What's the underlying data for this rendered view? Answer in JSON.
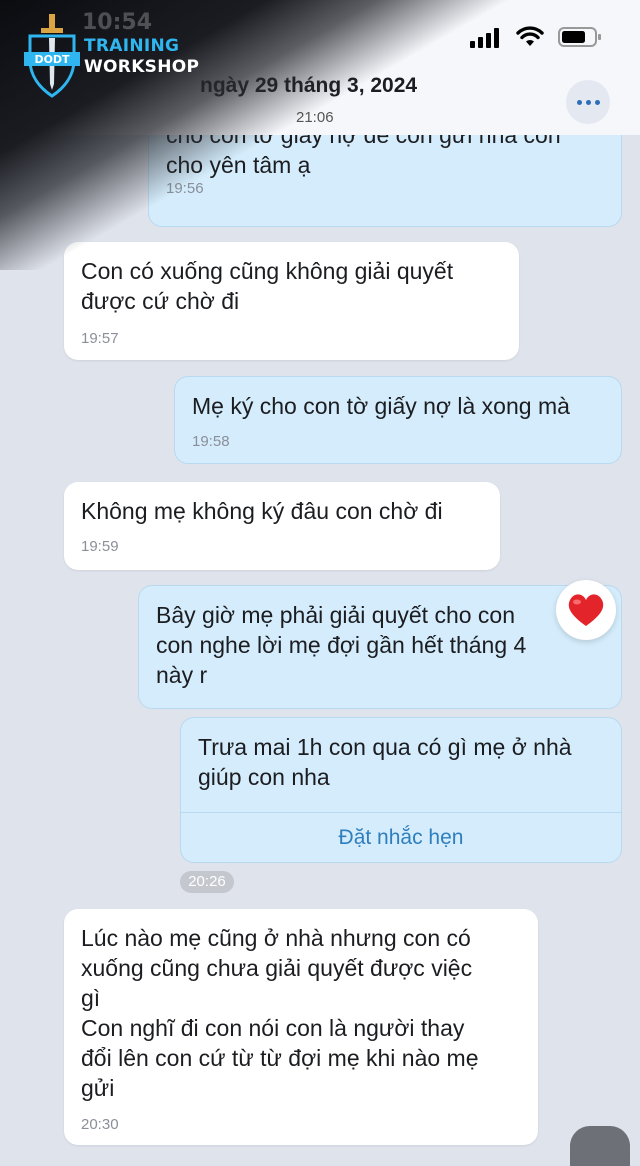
{
  "status_bar": {
    "time": "10:54"
  },
  "logo": {
    "line1": "TRAINING",
    "line2": "WORKSHOP",
    "badge": "DODT"
  },
  "header": {
    "date": "ngày 29 tháng 3, 2024",
    "time": "21:06",
    "more_icon": "more-dots-icon"
  },
  "messages": [
    {
      "side": "out",
      "text": "cho con tờ giấy nợ để con gửi nha con\ncho yên tâm ạ",
      "time": "19:56"
    },
    {
      "side": "in",
      "text": "Con có xuống cũng không giải quyết\nđược cứ chờ đi",
      "time": "19:57"
    },
    {
      "side": "out",
      "text": "Mẹ ký cho con tờ giấy nợ là xong mà",
      "time": "19:58"
    },
    {
      "side": "in",
      "text": "Không mẹ không ký đâu con chờ đi",
      "time": "19:59"
    },
    {
      "side": "out",
      "text": "Bây giờ mẹ phải giải quyết cho con\ncon nghe lời mẹ đợi gần hết tháng 4\nnày r",
      "reaction": "heart-icon"
    },
    {
      "side": "out",
      "text": "Trưa mai 1h con qua có gì mẹ ở nhà\ngiúp con nha",
      "action": "Đặt nhắc hẹn",
      "time": "20:26"
    },
    {
      "side": "in",
      "text": "Lúc nào mẹ cũng ở nhà nhưng con có\nxuống cũng chưa giải quyết được việc\ngì\nCon nghĩ đi con nói con là người thay\nđổi lên con cứ từ từ đợi mẹ khi nào mẹ\ngửi",
      "time": "20:30"
    }
  ],
  "colors": {
    "incoming": "#ffffff",
    "outgoing": "#d4ecfb",
    "accent": "#2f7fbf",
    "heart": "#e3242b"
  }
}
